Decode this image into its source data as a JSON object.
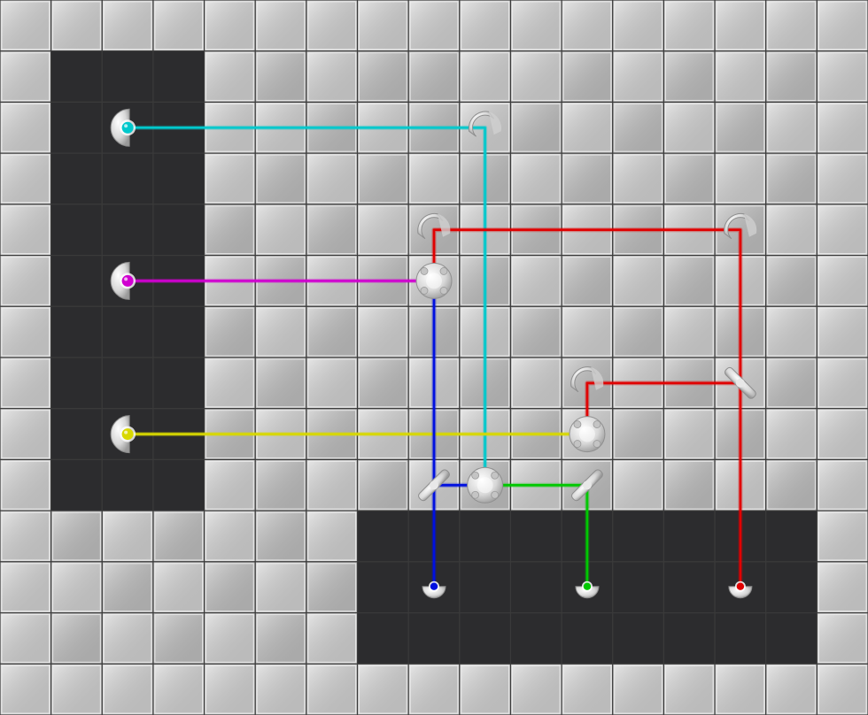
{
  "game": {
    "type": "laser-mirror-puzzle",
    "grid": {
      "columns": 17,
      "rows": 14
    },
    "colors": {
      "tile_light": "#d6d6d6",
      "tile_mid": "#c2c2c2",
      "tile_dark": "#2c2c2e",
      "grid_line": "#3a3a3a",
      "beam_cyan": "#00c8cc",
      "beam_magenta": "#d000d0",
      "beam_yellow": "#d8d800",
      "beam_red": "#e00000",
      "beam_blue": "#0010e0",
      "beam_green": "#00c800"
    },
    "dark_regions": [
      {
        "name": "emitter-panel",
        "col": 1,
        "row": 1,
        "cols": 3,
        "rows": 9
      },
      {
        "name": "receiver-panel",
        "col": 7,
        "row": 10,
        "cols": 9,
        "rows": 3
      }
    ],
    "mid_tiles": [
      [
        2,
        1
      ],
      [
        5,
        1
      ],
      [
        7,
        1
      ],
      [
        8,
        1
      ],
      [
        11,
        1
      ],
      [
        13,
        1
      ],
      [
        15,
        1
      ],
      [
        6,
        2
      ],
      [
        8,
        2
      ],
      [
        10,
        2
      ],
      [
        12,
        2
      ],
      [
        14,
        2
      ],
      [
        5,
        3
      ],
      [
        7,
        3
      ],
      [
        9,
        3
      ],
      [
        11,
        3
      ],
      [
        13,
        3
      ],
      [
        15,
        3
      ],
      [
        4,
        4
      ],
      [
        6,
        4
      ],
      [
        8,
        4
      ],
      [
        10,
        4
      ],
      [
        12,
        4
      ],
      [
        14,
        4
      ],
      [
        5,
        5
      ],
      [
        7,
        5
      ],
      [
        9,
        5
      ],
      [
        11,
        5
      ],
      [
        13,
        5
      ],
      [
        15,
        5
      ],
      [
        4,
        6
      ],
      [
        6,
        6
      ],
      [
        8,
        6
      ],
      [
        10,
        6
      ],
      [
        12,
        6
      ],
      [
        14,
        6
      ],
      [
        5,
        7
      ],
      [
        7,
        7
      ],
      [
        9,
        7
      ],
      [
        11,
        7
      ],
      [
        13,
        7
      ],
      [
        15,
        7
      ],
      [
        4,
        8
      ],
      [
        6,
        8
      ],
      [
        8,
        8
      ],
      [
        10,
        8
      ],
      [
        12,
        8
      ],
      [
        14,
        8
      ],
      [
        5,
        9
      ],
      [
        7,
        9
      ],
      [
        9,
        9
      ],
      [
        11,
        9
      ],
      [
        13,
        9
      ],
      [
        15,
        9
      ],
      [
        1,
        10
      ],
      [
        3,
        10
      ],
      [
        5,
        10
      ],
      [
        2,
        11
      ],
      [
        4,
        11
      ],
      [
        6,
        11
      ],
      [
        1,
        12
      ],
      [
        3,
        12
      ],
      [
        5,
        12
      ]
    ],
    "emitters": [
      {
        "name": "cyan-emitter",
        "color": "cyan",
        "col": 2,
        "row": 2
      },
      {
        "name": "magenta-emitter",
        "color": "magenta",
        "col": 2,
        "row": 5
      },
      {
        "name": "yellow-emitter",
        "color": "yellow",
        "col": 2,
        "row": 8
      }
    ],
    "receivers": [
      {
        "name": "blue-receiver",
        "color": "blue",
        "col": 8,
        "row": 11
      },
      {
        "name": "green-receiver",
        "color": "green",
        "col": 11,
        "row": 11
      },
      {
        "name": "red-receiver",
        "color": "red",
        "col": 14,
        "row": 11
      }
    ],
    "mirrors": [
      {
        "name": "mirror-cyan-corner",
        "kind": "curved",
        "col": 9,
        "row": 2
      },
      {
        "name": "mirror-red-top-left",
        "kind": "curved",
        "col": 8,
        "row": 4
      },
      {
        "name": "mirror-red-top-right",
        "kind": "curved",
        "col": 14,
        "row": 4
      },
      {
        "name": "splitter-magenta",
        "kind": "prism",
        "col": 8,
        "row": 5
      },
      {
        "name": "mirror-red-mid-left",
        "kind": "curved",
        "col": 11,
        "row": 7
      },
      {
        "name": "mirror-red-mid-right",
        "kind": "diagonal",
        "col": 14,
        "row": 7
      },
      {
        "name": "splitter-yellow",
        "kind": "prism",
        "col": 11,
        "row": 8
      },
      {
        "name": "mirror-blue-junction",
        "kind": "diagonal",
        "col": 8,
        "row": 9
      },
      {
        "name": "combiner-cyan",
        "kind": "prism",
        "col": 9,
        "row": 9
      },
      {
        "name": "mirror-green-junction",
        "kind": "diagonal",
        "col": 11,
        "row": 9
      }
    ],
    "beams": [
      {
        "name": "cyan-beam",
        "color": "cyan",
        "path": [
          [
            2.5,
            2.5
          ],
          [
            9.5,
            2.5
          ],
          [
            9.5,
            9.5
          ]
        ]
      },
      {
        "name": "magenta-beam",
        "color": "magenta",
        "path": [
          [
            2.5,
            5.5
          ],
          [
            8.5,
            5.5
          ]
        ]
      },
      {
        "name": "yellow-beam",
        "color": "yellow",
        "path": [
          [
            2.5,
            8.5
          ],
          [
            11.5,
            8.5
          ]
        ]
      },
      {
        "name": "red-beam-upper",
        "color": "red",
        "path": [
          [
            8.5,
            5.5
          ],
          [
            8.5,
            4.5
          ],
          [
            14.5,
            4.5
          ],
          [
            14.5,
            7.5
          ]
        ]
      },
      {
        "name": "red-beam-lower",
        "color": "red",
        "path": [
          [
            11.5,
            8.5
          ],
          [
            11.5,
            7.5
          ],
          [
            14.5,
            7.5
          ],
          [
            14.5,
            11.5
          ]
        ]
      },
      {
        "name": "blue-beam",
        "color": "blue",
        "path": [
          [
            8.5,
            5.5
          ],
          [
            8.5,
            11.5
          ]
        ]
      },
      {
        "name": "blue-link",
        "color": "blue",
        "path": [
          [
            8.5,
            9.5
          ],
          [
            9.5,
            9.5
          ]
        ]
      },
      {
        "name": "green-beam",
        "color": "green",
        "path": [
          [
            9.5,
            9.5
          ],
          [
            11.5,
            9.5
          ],
          [
            11.5,
            11.5
          ]
        ]
      }
    ]
  }
}
